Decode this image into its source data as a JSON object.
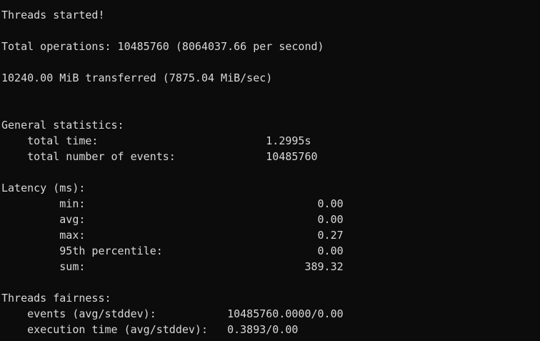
{
  "terminal": {
    "colors": {
      "background": "#0c0c0c",
      "text": "#d9d9d9"
    },
    "lines": [
      "Threads started!",
      "Total operations: 10485760 (8064037.66 per second)",
      "10240.00 MiB transferred (7875.04 MiB/sec)",
      "General statistics:",
      "    total time:                          1.2995s",
      "    total number of events:              10485760",
      "Latency (ms):",
      "         min:                                    0.00",
      "         avg:                                    0.00",
      "         max:                                    0.27",
      "         95th percentile:                        0.00",
      "         sum:                                  389.32",
      "Threads fairness:",
      "    events (avg/stddev):           10485760.0000/0.00",
      "    execution time (avg/stddev):   0.3893/0.00"
    ]
  }
}
